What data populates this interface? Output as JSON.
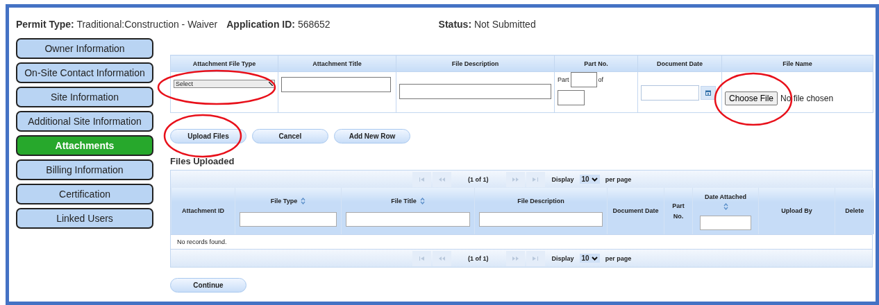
{
  "header": [
    {
      "label": "Permit Type:",
      "value": "Traditional:Construction - Waiver"
    },
    {
      "label": "Application ID:",
      "value": "568652"
    },
    {
      "label": "Status:",
      "value": "Not Submitted"
    }
  ],
  "sidebar": {
    "items": [
      {
        "label": "Owner Information",
        "selected": false
      },
      {
        "label": "On-Site Contact Information",
        "selected": false
      },
      {
        "label": "Site Information",
        "selected": false
      },
      {
        "label": "Additional Site Information",
        "selected": false
      },
      {
        "label": "Attachments",
        "selected": true
      },
      {
        "label": "Billing Information",
        "selected": false
      },
      {
        "label": "Certification",
        "selected": false
      },
      {
        "label": "Linked Users",
        "selected": false
      }
    ]
  },
  "upload_table": {
    "columns": [
      "Attachment File Type",
      "Attachment Title",
      "File Description",
      "Part No.",
      "Document Date",
      "File Name"
    ],
    "row": {
      "file_type": "Select",
      "part_label": "Part",
      "of_label": "of",
      "choose_file": "Choose File",
      "file_status": "No file chosen"
    }
  },
  "buttons": [
    "Upload Files",
    "Cancel",
    "Add New Row"
  ],
  "files_uploaded": {
    "title": "Files Uploaded",
    "paginators": [
      {
        "page": "(1 of 1)",
        "display_label": "Display",
        "per_page_value": "10",
        "per_page_label": "per page"
      },
      {
        "page": "(1 of 1)",
        "display_label": "Display",
        "per_page_value": "10",
        "per_page_label": "per page"
      }
    ],
    "columns": [
      {
        "label": "Attachment ID",
        "sortable": false,
        "filter": false
      },
      {
        "label": "File Type",
        "sortable": true,
        "filter": true
      },
      {
        "label": "File Title",
        "sortable": true,
        "filter": true
      },
      {
        "label": "File Description",
        "sortable": false,
        "filter": true
      },
      {
        "label": "Document Date",
        "sortable": false,
        "filter": false
      },
      {
        "label": "Part No.",
        "sortable": false,
        "filter": false
      },
      {
        "label": "Date Attached",
        "sortable": true,
        "filter": true
      },
      {
        "label": "Upload By",
        "sortable": false,
        "filter": false
      },
      {
        "label": "Delete",
        "sortable": false,
        "filter": false
      }
    ],
    "empty_message": "No records found."
  },
  "continue_button": "Continue"
}
